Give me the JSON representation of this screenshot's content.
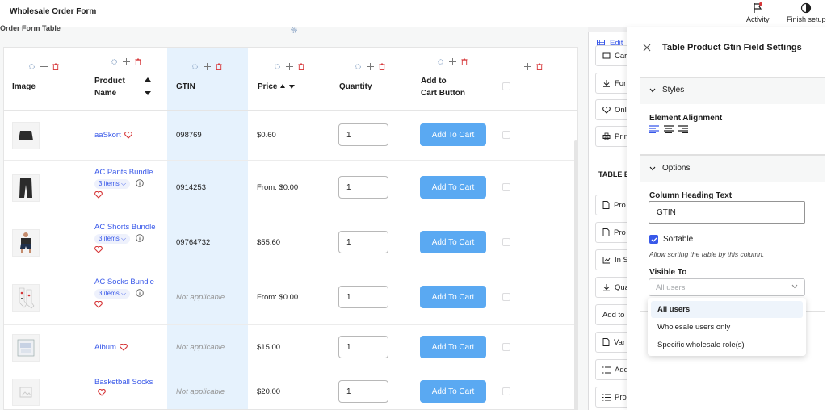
{
  "app": {
    "title": "Wholesale Order Form",
    "activity_label": "Activity",
    "finish_setup_label": "Finish setup"
  },
  "canvas": {
    "label": "Order Form Table"
  },
  "table": {
    "headers": {
      "image": "Image",
      "product_name_line1": "Product",
      "product_name_line2": "Name",
      "gtin": "GTIN",
      "price": "Price",
      "quantity": "Quantity",
      "cart_line1": "Add to",
      "cart_line2": "Cart Button"
    },
    "add_to_cart_label": "Add To Cart",
    "rows": [
      {
        "name": "aaSkort",
        "items": "",
        "gtin": "098769",
        "gtin_na": false,
        "price": "$0.60",
        "qty": "1"
      },
      {
        "name": "AC Pants Bundle",
        "items": "3 items",
        "gtin": "0914253",
        "gtin_na": false,
        "price": "From: $0.00",
        "qty": "1"
      },
      {
        "name": "AC Shorts Bundle",
        "items": "3 items",
        "gtin": "09764732",
        "gtin_na": false,
        "price": "$55.60",
        "qty": "1"
      },
      {
        "name": "AC Socks Bundle",
        "items": "3 items",
        "gtin": "Not applicable",
        "gtin_na": true,
        "price": "From: $0.00",
        "qty": "1"
      },
      {
        "name": "Album",
        "items": "",
        "gtin": "Not applicable",
        "gtin_na": true,
        "price": "$15.00",
        "qty": "1"
      },
      {
        "name": "Basketball Socks",
        "items": "",
        "gtin": "Not applicable",
        "gtin_na": true,
        "price": "$20.00",
        "qty": "1"
      }
    ]
  },
  "blocks_panel": {
    "tab_label": "Edit",
    "section_heading": "TABLE E",
    "items": [
      "Car",
      "For",
      "Onl",
      "Prin",
      "Pro",
      "Pro",
      "In S",
      "Qua",
      "Add to",
      "Var",
      "Add",
      "Pro"
    ]
  },
  "settings": {
    "title": "Table Product Gtin Field Settings",
    "styles_label": "Styles",
    "element_alignment_label": "Element Alignment",
    "options_label": "Options",
    "column_heading_label": "Column Heading Text",
    "column_heading_value": "GTIN",
    "sortable_label": "Sortable",
    "sortable_help": "Allow sorting the table by this column.",
    "visible_to_label": "Visible To",
    "visible_to_placeholder": "All users",
    "visible_to_options": [
      "All users",
      "Wholesale users only",
      "Specific wholesale role(s)"
    ]
  },
  "colors": {
    "accent": "#3858e9",
    "button": "#5aa9f2",
    "gtin_highlight": "#e6f2fd",
    "heart": "#d63638",
    "delete": "#d63638"
  }
}
